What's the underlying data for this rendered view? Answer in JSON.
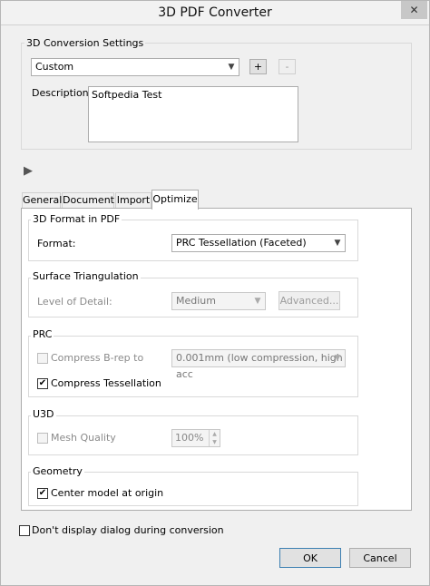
{
  "window": {
    "title": "3D PDF Converter",
    "close_glyph": "✕"
  },
  "conversion": {
    "group_label": "3D Conversion Settings",
    "preset_value": "Custom",
    "add_label": "+",
    "remove_label": "-",
    "description_label": "Description",
    "description_value": "Softpedia Test"
  },
  "play_glyph": "▶",
  "tabs": [
    {
      "label": "General",
      "active": false
    },
    {
      "label": "Document",
      "active": false
    },
    {
      "label": "Import",
      "active": false
    },
    {
      "label": "Optimize",
      "active": true
    }
  ],
  "format_group": {
    "label": "3D Format in PDF",
    "format_label": "Format:",
    "format_value": "PRC Tessellation (Faceted)"
  },
  "surface_group": {
    "label": "Surface Triangulation",
    "lod_label": "Level of Detail:",
    "lod_value": "Medium",
    "advanced_label": "Advanced..."
  },
  "prc_group": {
    "label": "PRC",
    "compress_brep_label": "Compress B-rep to",
    "compress_brep_checked": false,
    "brep_value": "0.001mm (low compression, high acc",
    "compress_tess_label": "Compress Tessellation",
    "compress_tess_checked": true
  },
  "u3d_group": {
    "label": "U3D",
    "mesh_label": "Mesh Quality",
    "mesh_checked": false,
    "mesh_value": "100%"
  },
  "geometry_group": {
    "label": "Geometry",
    "center_label": "Center model at origin",
    "center_checked": true
  },
  "dont_display_label": "Don't display dialog during conversion",
  "dont_display_checked": false,
  "ok_label": "OK",
  "cancel_label": "Cancel",
  "check_glyph": "✔",
  "arrow_glyph": "▼",
  "spin_up": "▲",
  "spin_down": "▼"
}
